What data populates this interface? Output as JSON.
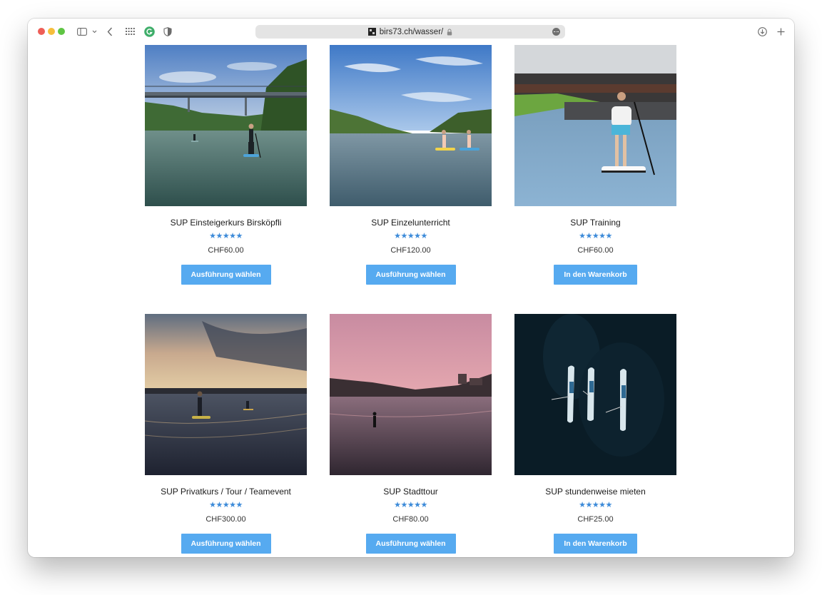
{
  "browser": {
    "url": "birs73.ch/wasser/",
    "site_icon": "site-logo-icon",
    "lock_icon": "lock-icon",
    "traffic_light_colors": {
      "close": "#ee5e57",
      "minimize": "#f6be3b",
      "zoom": "#5fc544"
    }
  },
  "theme": {
    "accent_button": "#56aaf0",
    "star_color": "#3d8bd9"
  },
  "products": [
    {
      "title": "SUP Einsteigerkurs Birsköpfli",
      "rating": 5,
      "stars": "★★★★★",
      "price": "CHF60.00",
      "button": "Ausführung wählen"
    },
    {
      "title": "SUP Einzelunterricht",
      "rating": 5,
      "stars": "★★★★★",
      "price": "CHF120.00",
      "button": "Ausführung wählen"
    },
    {
      "title": "SUP Training",
      "rating": 5,
      "stars": "★★★★★",
      "price": "CHF60.00",
      "button": "In den Warenkorb"
    },
    {
      "title": "SUP Privatkurs / Tour / Teamevent",
      "rating": 5,
      "stars": "★★★★★",
      "price": "CHF300.00",
      "button": "Ausführung wählen"
    },
    {
      "title": "SUP Stadttour",
      "rating": 5,
      "stars": "★★★★★",
      "price": "CHF80.00",
      "button": "Ausführung wählen"
    },
    {
      "title": "SUP stundenweise mieten",
      "rating": 4.8,
      "stars": "★★★★★",
      "price": "CHF25.00",
      "button": "In den Warenkorb"
    }
  ]
}
